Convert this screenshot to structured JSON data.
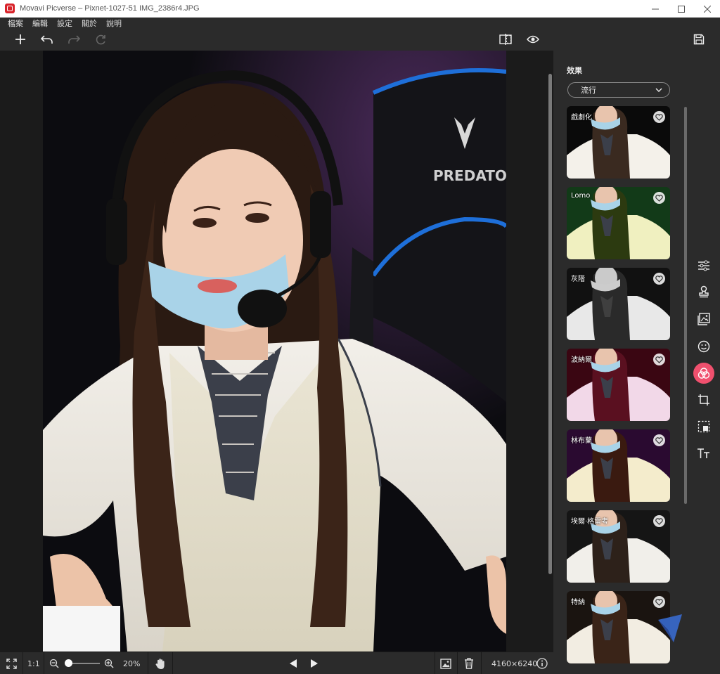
{
  "window": {
    "title": "Movavi Picverse – Pixnet-1027-51 IMG_2386r4.JPG",
    "controls": [
      "minimize-icon",
      "maximize-icon",
      "close-icon"
    ]
  },
  "menu": {
    "items": [
      "檔案",
      "編輯",
      "設定",
      "關於",
      "說明"
    ]
  },
  "toolbar": {
    "left_icons": [
      "add-icon",
      "undo-icon",
      "redo-icon",
      "reset-icon"
    ],
    "center_icons": [
      "compare-icon",
      "preview-eye-icon"
    ],
    "right_icons": [
      "save-icon"
    ]
  },
  "effects": {
    "title": "效果",
    "category": "流行",
    "items": [
      {
        "label": "戲劇化"
      },
      {
        "label": "Lomo"
      },
      {
        "label": "灰階"
      },
      {
        "label": "波納爾"
      },
      {
        "label": "林布蘭"
      },
      {
        "label": "埃爾·格雷考"
      },
      {
        "label": "特納"
      }
    ]
  },
  "tool_rail": {
    "items": [
      "adjust-sliders-icon",
      "stamp-icon",
      "image-icon",
      "face-icon",
      "effects-icon",
      "crop-icon",
      "select-icon",
      "text-icon"
    ],
    "active": "effects-icon"
  },
  "bottom": {
    "fullscreen_icon": "fullscreen-icon",
    "actual_size": "1:1",
    "zoom": "20%",
    "zoom_level": 0.1,
    "dimensions": "4160×6240",
    "icons": [
      "zoom-out-icon",
      "zoom-in-icon",
      "hand-icon",
      "prev-icon",
      "next-icon",
      "gallery-icon",
      "trash-icon",
      "info-icon"
    ]
  },
  "colors": {
    "accent": "#f0506e",
    "panel": "#2b2b2b",
    "background": "#1b1b1b"
  }
}
